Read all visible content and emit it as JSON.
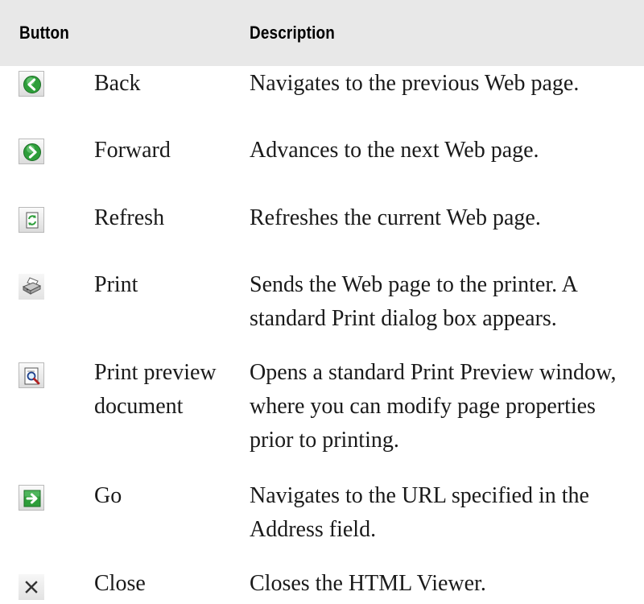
{
  "table": {
    "headers": {
      "button": "Button",
      "description": "Description"
    },
    "rows": [
      {
        "icon": "back-arrow-icon",
        "name": "Back",
        "description": "Navigates to the previous Web page."
      },
      {
        "icon": "forward-arrow-icon",
        "name": "Forward",
        "description": "Advances to the next Web page."
      },
      {
        "icon": "refresh-icon",
        "name": "Refresh",
        "description": "Refreshes the current Web page."
      },
      {
        "icon": "printer-icon",
        "name": "Print",
        "description": "Sends the Web page to the printer. A standard Print dialog box appears."
      },
      {
        "icon": "print-preview-icon",
        "name": "Print preview document",
        "description": "Opens a standard Print Preview window, where you can modify page properties prior to printing."
      },
      {
        "icon": "go-arrow-icon",
        "name": "Go",
        "description": "Navigates to the URL specified in the Address field."
      },
      {
        "icon": "close-icon",
        "name": "Close",
        "description": "Closes the HTML Viewer."
      }
    ]
  },
  "colors": {
    "header_bg": "#e8e8e8",
    "icon_green": "#2e9e3a",
    "text": "#1a1a1a"
  }
}
